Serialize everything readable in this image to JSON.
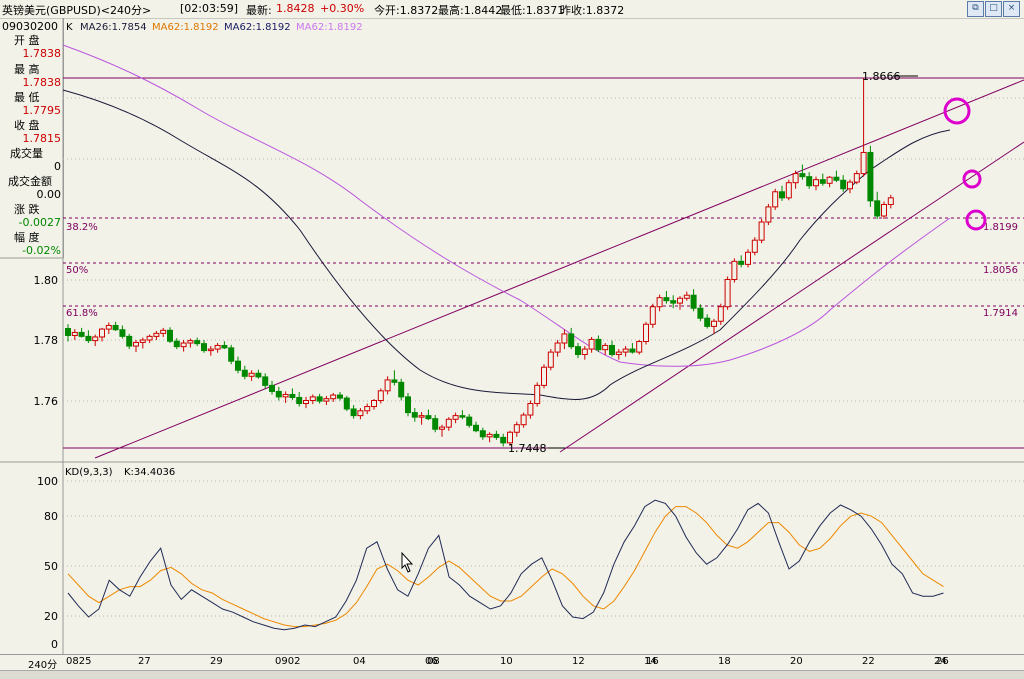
{
  "header": {
    "instrument": "英镑美元(GBPUSD)<240分>",
    "time": "[02:03:59]",
    "last_label": "最新:",
    "last_value": "1.8428",
    "change": "+0.30%",
    "open_label": "今开:1.8372",
    "high_label": "最高:1.8442",
    "low_label": "最低:1.8371",
    "prev_label": "昨收:1.8372"
  },
  "ma_line": {
    "k": "K",
    "ma1": "MA26:1.7854",
    "ma2": "MA62:1.8192",
    "ma3": "MA62:1.8192",
    "ma4": "MA62:1.8192"
  },
  "info": {
    "date": "09030200",
    "open_label": "开  盘",
    "open_value": "1.7838",
    "high_label": "最  高",
    "high_value": "1.7838",
    "low_label": "最  低",
    "low_value": "1.7795",
    "close_label": "收  盘",
    "close_value": "1.7815",
    "vol_label": "成交量",
    "vol_value": "0",
    "amount_label": "成交金额",
    "amount_value": "0.00",
    "chg_label": "涨  跌",
    "chg_value": "-0.0027",
    "pct_label": "幅  度",
    "pct_value": "-0.02%"
  },
  "price_axis": [
    "1.80",
    "1.78",
    "1.76"
  ],
  "fib": {
    "l1": "38.2%",
    "v1": "1.8199",
    "l2": "50%",
    "v2": "1.8056",
    "l3": "61.8%",
    "v3": "1.7914"
  },
  "annotations": {
    "high": "1.8666",
    "low": "1.7448"
  },
  "kd": {
    "title": "KD(9,3,3)",
    "value": "K:34.4036",
    "axis": [
      "100",
      "80",
      "50",
      "20",
      "0"
    ]
  },
  "x_axis": {
    "period": "240分",
    "labels": [
      "0825",
      "27",
      "29",
      "0902",
      "04",
      "06",
      "08",
      "10",
      "12",
      "14",
      "16",
      "18",
      "20",
      "22",
      "24",
      "26"
    ]
  },
  "colors": {
    "up": "#cc0000",
    "down": "#008800",
    "ma_short": "#1a1a3a",
    "ma_long": "#bb55dd",
    "channel": "#800060",
    "circle": "#dd00cc",
    "k_line": "#202a55",
    "d_line": "#ee8800"
  },
  "icons": [
    "window-restore-icon",
    "window-max-icon",
    "window-close-icon"
  ]
}
